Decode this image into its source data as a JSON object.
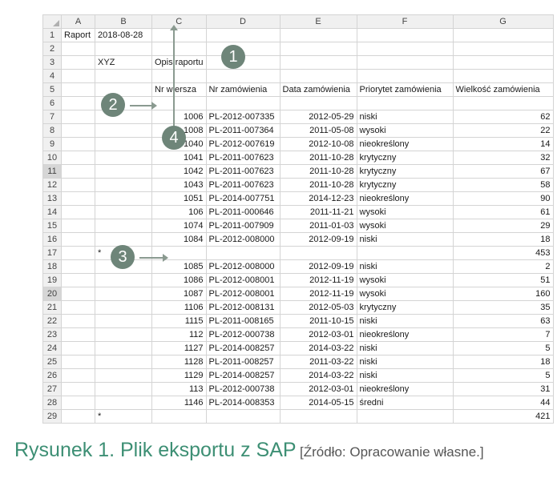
{
  "columns": [
    "A",
    "B",
    "C",
    "D",
    "E",
    "F",
    "G"
  ],
  "rows": [
    {
      "n": "1",
      "A": "Raport",
      "B": "2018-08-28"
    },
    {
      "n": "2"
    },
    {
      "n": "3",
      "B": "XYZ",
      "C": "Opis raportu"
    },
    {
      "n": "4"
    },
    {
      "n": "5",
      "C": "Nr wiersza",
      "D": "Nr zamówienia",
      "E": "Data zamówienia",
      "F": "Priorytet zamówienia",
      "G": "Wielkość zamówienia"
    },
    {
      "n": "6"
    },
    {
      "n": "7",
      "C": "1006",
      "D": "PL-2012-007335",
      "E": "2012-05-29",
      "F": "niski",
      "G": "62"
    },
    {
      "n": "8",
      "C": "1008",
      "D": "PL-2011-007364",
      "E": "2011-05-08",
      "F": "wysoki",
      "G": "22"
    },
    {
      "n": "9",
      "C": "1040",
      "D": "PL-2012-007619",
      "E": "2012-10-08",
      "F": "nieokreślony",
      "G": "14"
    },
    {
      "n": "10",
      "C": "1041",
      "D": "PL-2011-007623",
      "E": "2011-10-28",
      "F": "krytyczny",
      "G": "32"
    },
    {
      "n": "11",
      "C": "1042",
      "D": "PL-2011-007623",
      "E": "2011-10-28",
      "F": "krytyczny",
      "G": "67"
    },
    {
      "n": "12",
      "C": "1043",
      "D": "PL-2011-007623",
      "E": "2011-10-28",
      "F": "krytyczny",
      "G": "58"
    },
    {
      "n": "13",
      "C": "1051",
      "D": "PL-2014-007751",
      "E": "2014-12-23",
      "F": "nieokreślony",
      "G": "90"
    },
    {
      "n": "14",
      "C": "106",
      "D": "PL-2011-000646",
      "E": "2011-11-21",
      "F": "wysoki",
      "G": "61"
    },
    {
      "n": "15",
      "C": "1074",
      "D": "PL-2011-007909",
      "E": "2011-01-03",
      "F": "wysoki",
      "G": "29"
    },
    {
      "n": "16",
      "C": "1084",
      "D": "PL-2012-008000",
      "E": "2012-09-19",
      "F": "niski",
      "G": "18"
    },
    {
      "n": "17",
      "B": "*",
      "G": "453"
    },
    {
      "n": "18",
      "C": "1085",
      "D": "PL-2012-008000",
      "E": "2012-09-19",
      "F": "niski",
      "G": "2"
    },
    {
      "n": "19",
      "C": "1086",
      "D": "PL-2012-008001",
      "E": "2012-11-19",
      "F": "wysoki",
      "G": "51"
    },
    {
      "n": "20",
      "C": "1087",
      "D": "PL-2012-008001",
      "E": "2012-11-19",
      "F": "wysoki",
      "G": "160"
    },
    {
      "n": "21",
      "C": "1106",
      "D": "PL-2012-008131",
      "E": "2012-05-03",
      "F": "krytyczny",
      "G": "35"
    },
    {
      "n": "22",
      "C": "1115",
      "D": "PL-2011-008165",
      "E": "2011-10-15",
      "F": "niski",
      "G": "63"
    },
    {
      "n": "23",
      "C": "112",
      "D": "PL-2012-000738",
      "E": "2012-03-01",
      "F": "nieokreślony",
      "G": "7"
    },
    {
      "n": "24",
      "C": "1127",
      "D": "PL-2014-008257",
      "E": "2014-03-22",
      "F": "niski",
      "G": "5"
    },
    {
      "n": "25",
      "C": "1128",
      "D": "PL-2011-008257",
      "E": "2011-03-22",
      "F": "niski",
      "G": "18"
    },
    {
      "n": "26",
      "C": "1129",
      "D": "PL-2014-008257",
      "E": "2014-03-22",
      "F": "niski",
      "G": "5"
    },
    {
      "n": "27",
      "C": "113",
      "D": "PL-2012-000738",
      "E": "2012-03-01",
      "F": "nieokreślony",
      "G": "31"
    },
    {
      "n": "28",
      "C": "1146",
      "D": "PL-2014-008353",
      "E": "2014-05-15",
      "F": "średni",
      "G": "44"
    },
    {
      "n": "29",
      "B": "*",
      "G": "421"
    }
  ],
  "markers": {
    "m1": "1",
    "m2": "2",
    "m3": "3",
    "m4": "4"
  },
  "caption": {
    "title": "Rysunek 1. Plik eksportu z SAP",
    "source": "[Źródło: Opracowanie własne.]"
  },
  "colors": {
    "accent": "#3d8f74",
    "marker": "#6e8579",
    "arrow": "#8a9a90",
    "grid": "#d4d4d4",
    "header_bg": "#f0f0f0"
  }
}
